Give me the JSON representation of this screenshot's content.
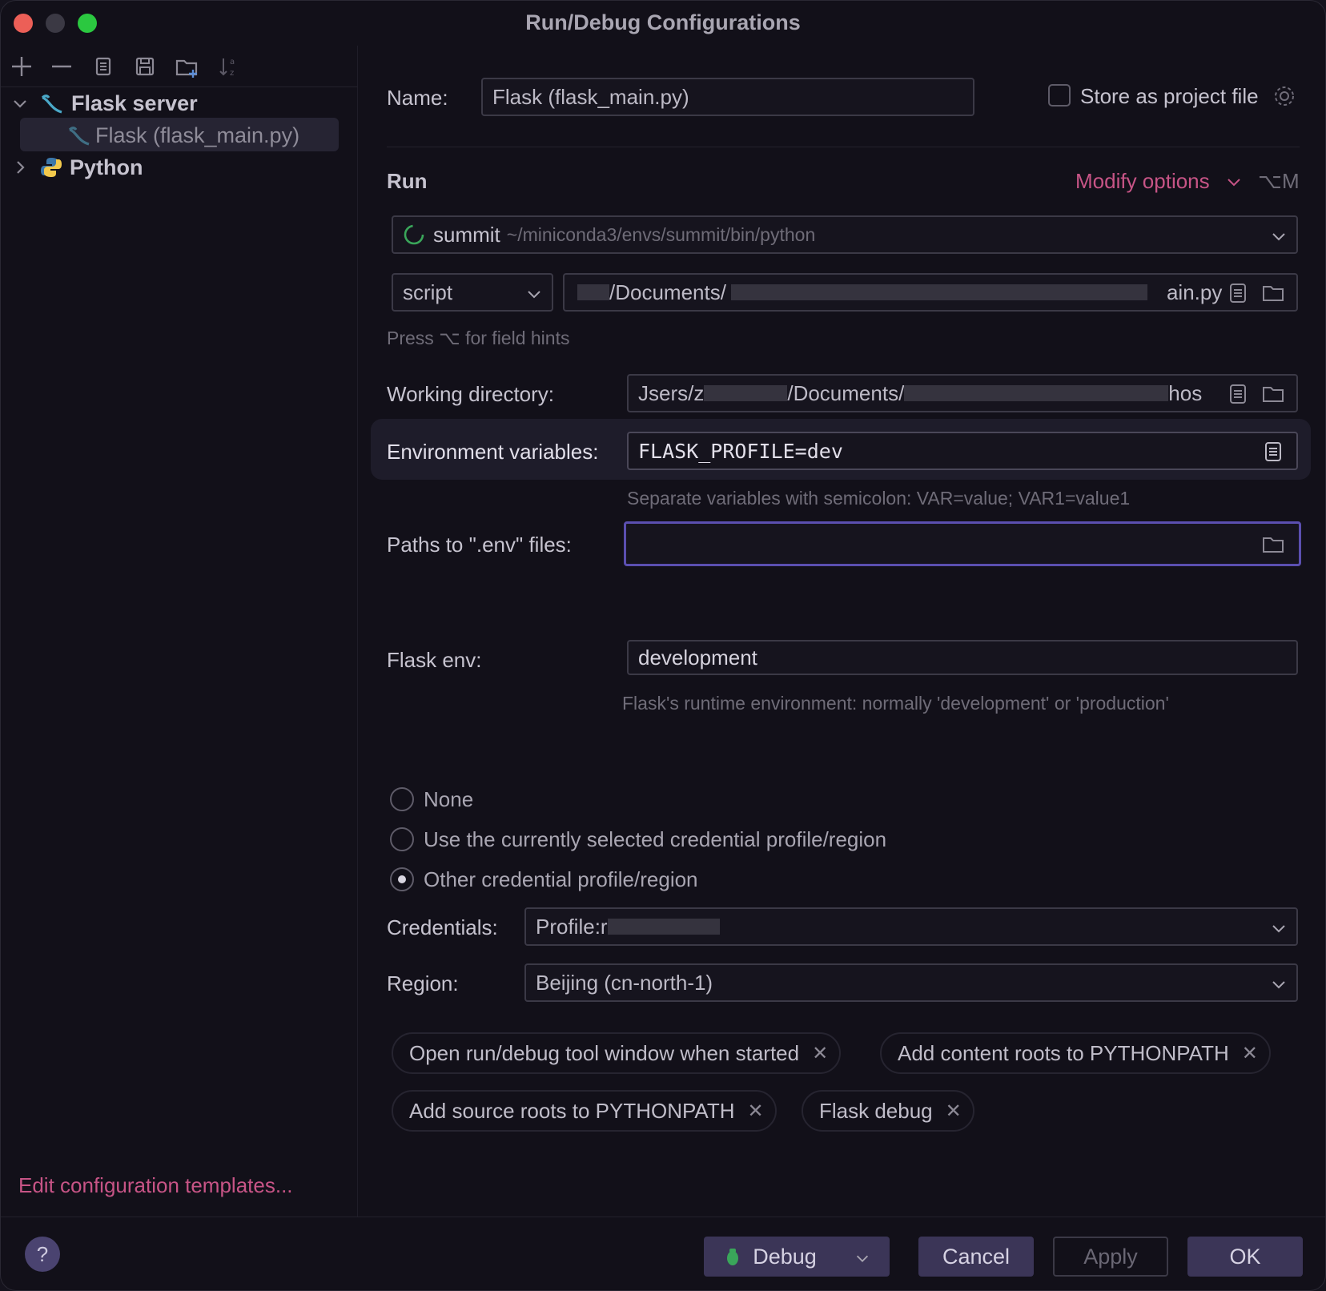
{
  "window": {
    "title": "Run/Debug Configurations"
  },
  "tree": {
    "groups": [
      {
        "label": "Flask server",
        "expanded": true,
        "icon": "flask-icon",
        "children": [
          {
            "label": "Flask (flask_main.py)",
            "selected": true,
            "icon": "flask-icon"
          }
        ]
      },
      {
        "label": "Python",
        "expanded": false,
        "icon": "python-icon",
        "children": []
      }
    ],
    "edit_templates_link": "Edit configuration templates..."
  },
  "form": {
    "name_label": "Name:",
    "name_value": "Flask (flask_main.py)",
    "store_label": "Store as project file",
    "store_checked": false,
    "section_run": "Run",
    "modify_options": "Modify options",
    "modify_shortcut": "⌥M",
    "interpreter": {
      "name": "summit",
      "path": "~/miniconda3/envs/summit/bin/python"
    },
    "target_type": "script",
    "script_path_prefix": "/Documents/",
    "script_path_suffix": "ain.py",
    "field_hints": "Press ⌥ for field hints",
    "workdir_label": "Working directory:",
    "workdir_prefix": "Jsers/z",
    "workdir_middle": "/Documents/",
    "workdir_suffix": "hos",
    "env_label": "Environment variables:",
    "env_value": "FLASK_PROFILE=dev",
    "env_hint": "Separate variables with semicolon: VAR=value; VAR1=value1",
    "dotenv_label": "Paths to \".env\" files:",
    "dotenv_value": "",
    "flask_env_label": "Flask env:",
    "flask_env_value": "development",
    "flask_env_hint": "Flask's runtime environment: normally 'development' or 'production'",
    "credential_options": [
      {
        "label": "None",
        "selected": false
      },
      {
        "label": "Use the currently selected credential profile/region",
        "selected": false
      },
      {
        "label": "Other credential profile/region",
        "selected": true
      }
    ],
    "credentials_label": "Credentials:",
    "credentials_value": "Profile:r",
    "region_label": "Region:",
    "region_value": "Beijing (cn-north-1)",
    "chips": [
      "Open run/debug tool window when started",
      "Add content roots to PYTHONPATH",
      "Add source roots to PYTHONPATH",
      "Flask debug"
    ]
  },
  "footer": {
    "help": "?",
    "debug": "Debug",
    "cancel": "Cancel",
    "apply": "Apply",
    "ok": "OK"
  },
  "colors": {
    "accent": "#c75486",
    "focus": "#6a5acd",
    "background": "#121019"
  }
}
